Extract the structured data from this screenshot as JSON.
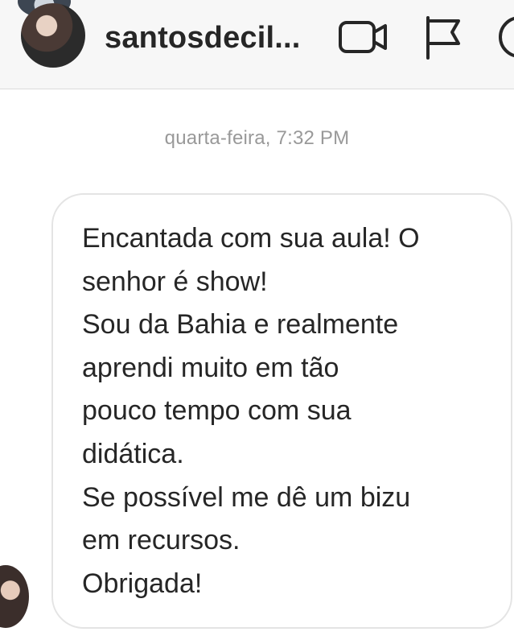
{
  "header": {
    "username": "santosdecil...",
    "icons": {
      "video": "video-camera-icon",
      "flag": "flag-icon",
      "info": "info-icon",
      "close": "close-icon"
    }
  },
  "thread": {
    "timestamp": "quarta-feira, 7:32 PM",
    "message": {
      "lines": [
        "Encantada com sua aula! O",
        "senhor é show!",
        "Sou da Bahia e realmente",
        "aprendi muito em tão",
        "pouco tempo com sua",
        "didática.",
        "Se possível me dê um bizu",
        "em recursos.",
        "Obrigada!"
      ]
    }
  },
  "colors": {
    "header_bg": "#f7f7f7",
    "text": "#262626",
    "timestamp": "#999999",
    "bubble_border": "#e4e4e4"
  }
}
